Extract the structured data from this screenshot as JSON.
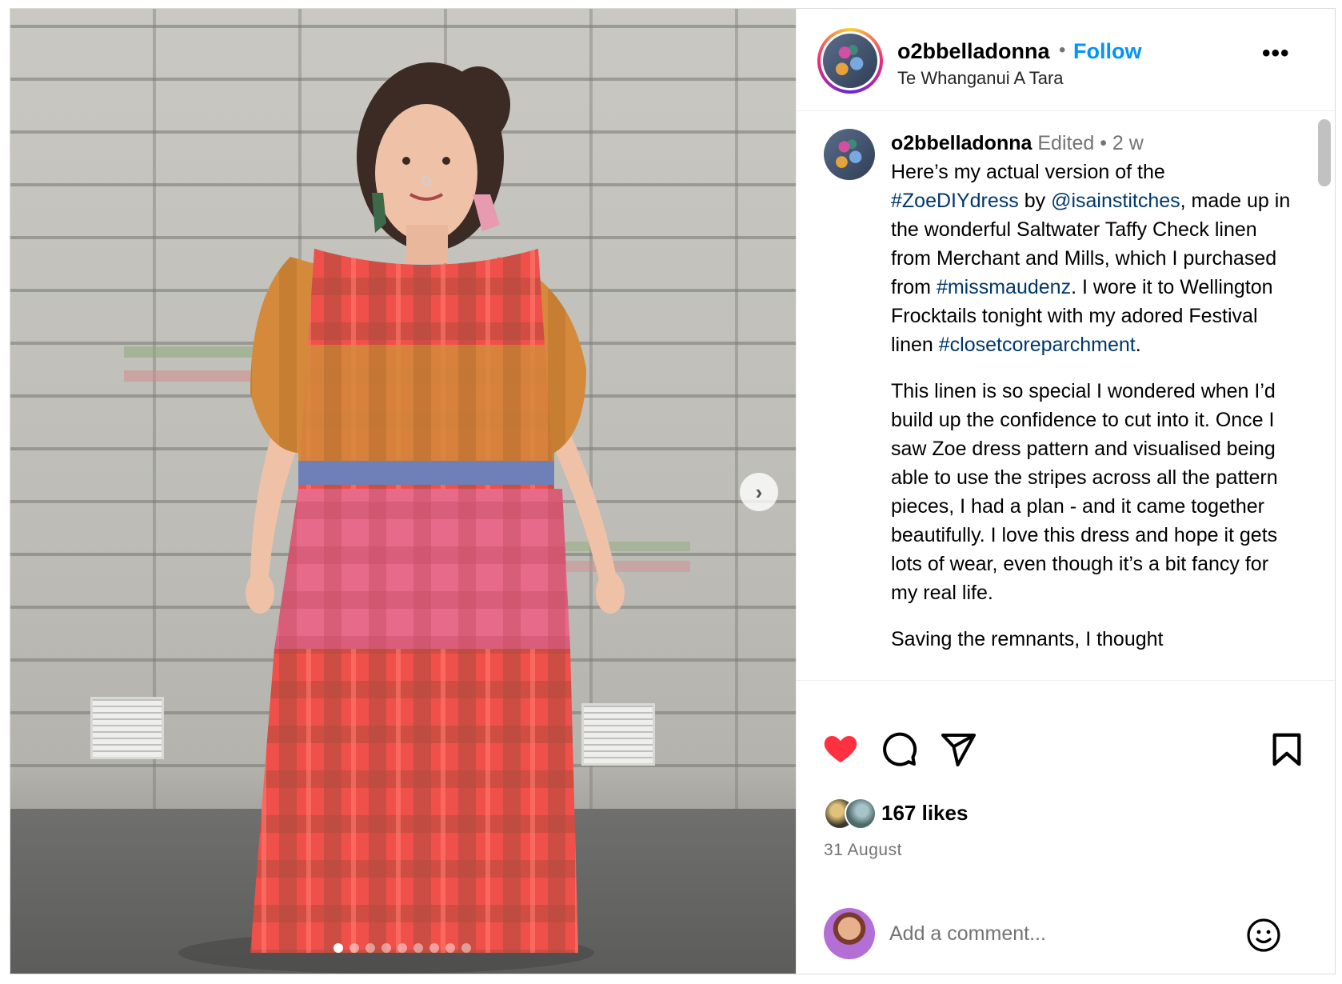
{
  "post": {
    "username": "o2bbelladonna",
    "follow_label": "Follow",
    "separator": "•",
    "location": "Te Whanganui A Tara",
    "more_label": "•••"
  },
  "caption": {
    "username": "o2bbelladonna",
    "edited": "Edited",
    "separator": "•",
    "age": "2 w",
    "p1": {
      "t1": "Here’s my actual version of the ",
      "tag1": "#ZoeDIYdress",
      "t2": " by ",
      "mention": "@isainstitches",
      "t3": ", made up in the wonderful Saltwater Taffy Check linen from Merchant and Mills, which I purchased from ",
      "tag2": "#missmaudenz",
      "t4": ". I wore it to Wellington Frocktails tonight with my adored Festival linen ",
      "tag3": "#closetcoreparchment",
      "t5": "."
    },
    "p2": "This linen is so special I wondered when I’d build up the confidence to cut into it. Once I saw Zoe dress pattern and visualised being able to use the stripes across all the pattern pieces, I had a plan - and it came together beautifully. I love this dress and hope it gets lots of wear, even though it’s a bit fancy for my real life.",
    "p3": "Saving the remnants, I thought"
  },
  "engagement": {
    "likes": "167 likes",
    "date": "31 August"
  },
  "comment": {
    "placeholder": "Add a comment..."
  },
  "media": {
    "next_label": "›",
    "slide_count": 9,
    "active_slide": 1
  },
  "colors": {
    "accent": "#0095f6",
    "like": "#ff3040",
    "link": "#00376b",
    "muted": "#737373"
  },
  "icons": [
    "heart-icon",
    "comment-icon",
    "share-icon",
    "bookmark-icon",
    "emoji-icon",
    "chevron-right-icon"
  ]
}
